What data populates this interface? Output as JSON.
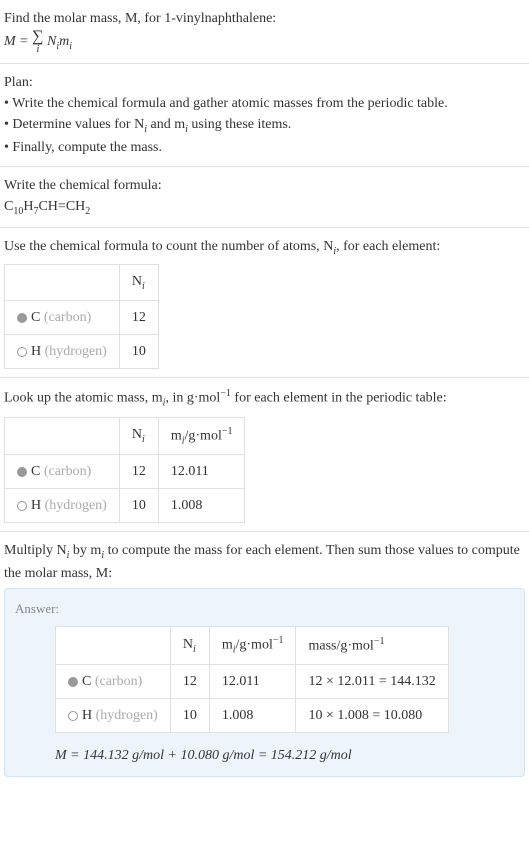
{
  "intro": {
    "line1": "Find the molar mass, M, for 1-vinylnaphthalene:",
    "formula_prefix": "M = ",
    "formula_sum_idx": "i",
    "formula_terms": "N_i m_i"
  },
  "plan": {
    "header": "Plan:",
    "items": [
      "• Write the chemical formula and gather atomic masses from the periodic table.",
      "• Determine values for N_i and m_i using these items.",
      "• Finally, compute the mass."
    ]
  },
  "chemformula": {
    "header": "Write the chemical formula:",
    "formula": "C_{10}H_{7}CH=CH_{2}"
  },
  "atomcount": {
    "header": "Use the chemical formula to count the number of atoms, N_i, for each element:",
    "col_ni": "N_i",
    "rows": [
      {
        "sym": "C",
        "name": "(carbon)",
        "ni": "12",
        "marker": "filled"
      },
      {
        "sym": "H",
        "name": "(hydrogen)",
        "ni": "10",
        "marker": "empty"
      }
    ]
  },
  "atomicmass": {
    "header": "Look up the atomic mass, m_i, in g·mol^{-1} for each element in the periodic table:",
    "col_ni": "N_i",
    "col_mi": "m_i/g·mol^{-1}",
    "rows": [
      {
        "sym": "C",
        "name": "(carbon)",
        "ni": "12",
        "mi": "12.011",
        "marker": "filled"
      },
      {
        "sym": "H",
        "name": "(hydrogen)",
        "ni": "10",
        "mi": "1.008",
        "marker": "empty"
      }
    ]
  },
  "multiply": {
    "header": "Multiply N_i by m_i to compute the mass for each element. Then sum those values to compute the molar mass, M:"
  },
  "answer": {
    "label": "Answer:",
    "col_ni": "N_i",
    "col_mi": "m_i/g·mol^{-1}",
    "col_mass": "mass/g·mol^{-1}",
    "rows": [
      {
        "sym": "C",
        "name": "(carbon)",
        "ni": "12",
        "mi": "12.011",
        "mass": "12 × 12.011 = 144.132",
        "marker": "filled"
      },
      {
        "sym": "H",
        "name": "(hydrogen)",
        "ni": "10",
        "mi": "1.008",
        "mass": "10 × 1.008 = 10.080",
        "marker": "empty"
      }
    ],
    "final": "M = 144.132 g/mol + 10.080 g/mol = 154.212 g/mol"
  },
  "chart_data": {
    "type": "table",
    "title": "Molar mass of 1-vinylnaphthalene",
    "elements": [
      {
        "element": "C",
        "name": "carbon",
        "N_i": 12,
        "m_i_g_per_mol": 12.011,
        "mass_g_per_mol": 144.132
      },
      {
        "element": "H",
        "name": "hydrogen",
        "N_i": 10,
        "m_i_g_per_mol": 1.008,
        "mass_g_per_mol": 10.08
      }
    ],
    "molar_mass_g_per_mol": 154.212,
    "chemical_formula": "C10H7CH=CH2"
  }
}
